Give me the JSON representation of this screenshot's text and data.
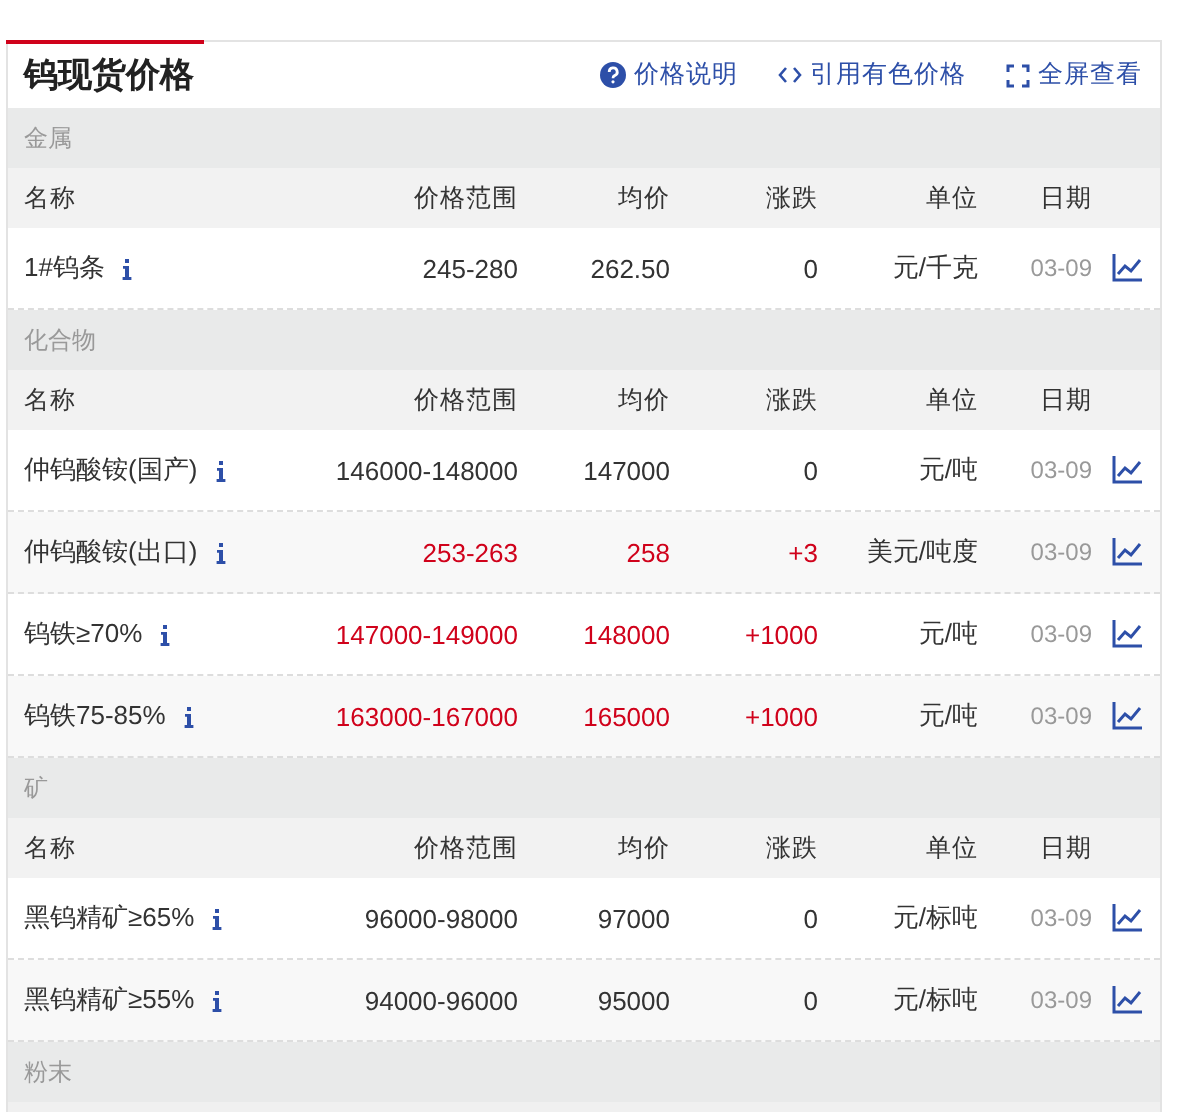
{
  "title": "钨现货价格",
  "actions": [
    {
      "kind": "help",
      "label": "价格说明"
    },
    {
      "kind": "code",
      "label": "引用有色价格"
    },
    {
      "kind": "fullscreen",
      "label": "全屏查看"
    }
  ],
  "sections": [
    {
      "name": "金属",
      "columns": [
        "名称",
        "价格范围",
        "均价",
        "涨跌",
        "单位",
        "日期"
      ],
      "rows": [
        {
          "name": "1#钨条",
          "range": "245-280",
          "avg": "262.50",
          "change": "0",
          "unit": "元/千克",
          "date": "03-09",
          "rising": false
        }
      ]
    },
    {
      "name": "化合物",
      "columns": [
        "名称",
        "价格范围",
        "均价",
        "涨跌",
        "单位",
        "日期"
      ],
      "rows": [
        {
          "name": "仲钨酸铵(国产)",
          "range": "146000-148000",
          "avg": "147000",
          "change": "0",
          "unit": "元/吨",
          "date": "03-09",
          "rising": false
        },
        {
          "name": "仲钨酸铵(出口)",
          "range": "253-263",
          "avg": "258",
          "change": "+3",
          "unit": "美元/吨度",
          "date": "03-09",
          "rising": true
        },
        {
          "name": "钨铁≥70%",
          "range": "147000-149000",
          "avg": "148000",
          "change": "+1000",
          "unit": "元/吨",
          "date": "03-09",
          "rising": true
        },
        {
          "name": "钨铁75-85%",
          "range": "163000-167000",
          "avg": "165000",
          "change": "+1000",
          "unit": "元/吨",
          "date": "03-09",
          "rising": true
        }
      ]
    },
    {
      "name": "矿",
      "columns": [
        "名称",
        "价格范围",
        "均价",
        "涨跌",
        "单位",
        "日期"
      ],
      "rows": [
        {
          "name": "黑钨精矿≥65%",
          "range": "96000-98000",
          "avg": "97000",
          "change": "0",
          "unit": "元/标吨",
          "date": "03-09",
          "rising": false
        },
        {
          "name": "黑钨精矿≥55%",
          "range": "94000-96000",
          "avg": "95000",
          "change": "0",
          "unit": "元/标吨",
          "date": "03-09",
          "rising": false
        }
      ]
    },
    {
      "name": "粉末"
    }
  ]
}
